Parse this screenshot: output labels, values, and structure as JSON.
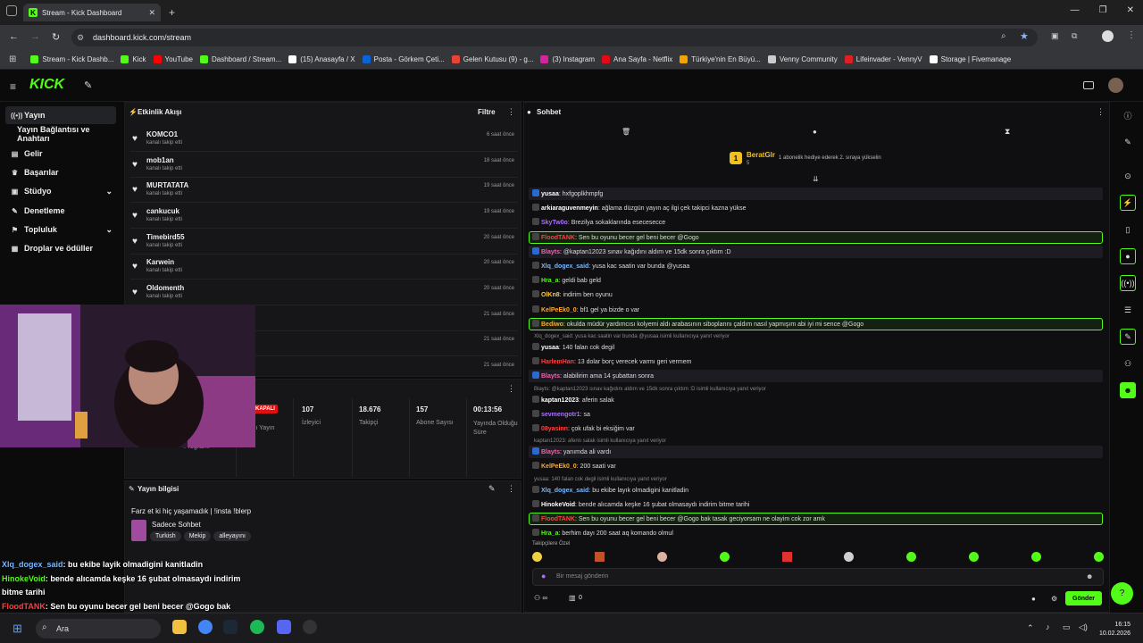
{
  "browser": {
    "tab_title": "Stream - Kick Dashboard",
    "url": "dashboard.kick.com/stream",
    "bookmarks": [
      {
        "label": "Stream - Kick Dashb...",
        "color": "#53fc18"
      },
      {
        "label": "Kick",
        "color": "#53fc18"
      },
      {
        "label": "YouTube",
        "color": "#ff0000"
      },
      {
        "label": "Dashboard / Stream...",
        "color": "#53fc18"
      },
      {
        "label": "(15) Anasayfa / X",
        "color": "#ffffff"
      },
      {
        "label": "Posta - Görkem Çeti...",
        "color": "#0a64d6"
      },
      {
        "label": "Gelen Kutusu (9) - g...",
        "color": "#ea4335"
      },
      {
        "label": "(3) Instagram",
        "color": "#d6249f"
      },
      {
        "label": "Ana Sayfa - Netflix",
        "color": "#e50914"
      },
      {
        "label": "Türkiye'nin En Büyü...",
        "color": "#f4a300"
      },
      {
        "label": "Venny Community",
        "color": "#cccccc"
      },
      {
        "label": "Lifeinvader - VennyV",
        "color": "#e02020"
      },
      {
        "label": "Storage | Fivemanage",
        "color": "#ffffff"
      }
    ]
  },
  "app": {
    "logo": "KICK"
  },
  "nav": {
    "items": [
      {
        "label": "Yayın",
        "icon": "broadcast-icon"
      },
      {
        "label": "Yayın Bağlantısı ve Anahtarı",
        "icon": ""
      },
      {
        "label": "Gelir",
        "icon": "wallet-icon"
      },
      {
        "label": "Başarılar",
        "icon": "trophy-icon"
      },
      {
        "label": "Stüdyo",
        "icon": "studio-icon"
      },
      {
        "label": "Denetleme",
        "icon": "wrench-icon"
      },
      {
        "label": "Topluluk",
        "icon": "community-icon"
      },
      {
        "label": "Droplar ve ödüller",
        "icon": "gift-icon"
      }
    ]
  },
  "activity": {
    "title": "Etkinlik Akışı",
    "filter": "Filtre",
    "items": [
      {
        "name": "KOMCO1",
        "sub": "kanalı takip etti",
        "time": "6 saat önce"
      },
      {
        "name": "mob1an",
        "sub": "kanalı takip etti",
        "time": "18 saat önce"
      },
      {
        "name": "MURTATATA",
        "sub": "kanalı takip etti",
        "time": "19 saat önce"
      },
      {
        "name": "cankucuk",
        "sub": "kanalı takip etti",
        "time": "19 saat önce"
      },
      {
        "name": "Timebird55",
        "sub": "kanalı takip etti",
        "time": "20 saat önce"
      },
      {
        "name": "Karwein",
        "sub": "kanalı takip etti",
        "time": "20 saat önce"
      },
      {
        "name": "Oldomenth",
        "sub": "kanalı takip etti",
        "time": "20 saat önce"
      },
      {
        "name": "",
        "sub": "",
        "time": "21 saat önce"
      },
      {
        "name": "",
        "sub": "",
        "time": "21 saat önce"
      },
      {
        "name": "",
        "sub": "",
        "time": "21 saat önce"
      }
    ]
  },
  "stats": {
    "live_label": "KAPALI",
    "live_sub": "Canlı Yayın",
    "program": "Programı",
    "viewers": "107",
    "viewers_label": "İzleyici",
    "followers": "18.676",
    "followers_label": "Takipçi",
    "subs": "157",
    "subs_label": "Abone Sayısı",
    "uptime": "00:13:56",
    "uptime_label": "Yayında Olduğu Süre"
  },
  "stream_info": {
    "title": "Yayın bilgisi",
    "stream_title": "Farz et ki hiç yaşamadık | !insta !blerp",
    "category": "Sadece Sohbet",
    "tags": [
      "Turkish",
      "Mekip",
      "alleyayını"
    ]
  },
  "chat": {
    "title": "Sohbet",
    "pinned_user": "BeratGlr",
    "pinned_count": "5",
    "pinned_msg": "1 abonelik hediye ederek 2. sıraya yükselin",
    "placeholder": "Bir mesaj gönderin",
    "send": "Gönder",
    "followers_only": "Takipçilere Özel",
    "bottom_count": "0",
    "messages": [
      {
        "user": "yusaa",
        "color": "#ffffff",
        "text": "hxfgoplkhmpfg",
        "style": "box"
      },
      {
        "user": "arkiaraguvenmeyin",
        "color": "#ffffff",
        "text": "ağlama düzgün yayın aç ilgi çek takipci kazna yükse",
        "style": ""
      },
      {
        "user": "SkyTw0o",
        "color": "#a970ff",
        "text": "Brezilya sokaklarında esecesecce",
        "style": ""
      },
      {
        "user": "FloodTANK",
        "color": "#ff4040",
        "text": "Sen bu oyunu becer gel beni becer @Gogo",
        "style": "hl"
      },
      {
        "user": "Blayts",
        "color": "#ff5db0",
        "text": "@kaptan12023 sınav kağıdını aldım ve 15dk sonra çıktım :D",
        "style": "box"
      },
      {
        "user": "Xlq_dogex_said",
        "color": "#7ab8ff",
        "text": "yusa kac saatin var bunda @yusaa",
        "style": ""
      },
      {
        "user": "Hra_a",
        "color": "#53fc18",
        "text": "geldi bab geld",
        "style": ""
      },
      {
        "user": "OlKn8",
        "color": "#ffcc33",
        "text": "indirim ben oyunu",
        "style": ""
      },
      {
        "user": "KelPeEk0_0",
        "color": "#ffaa33",
        "text": "bf1 gel ya bizde o var",
        "style": ""
      },
      {
        "user": "Bediwo",
        "color": "#ffaa33",
        "text": "okulda müdür yardımcısı kolyemi aldı arabasının siboplarını çaldım nasıl yapmışım abi iyi mi sence @Gogo",
        "style": "hl"
      },
      {
        "user": "yusaa",
        "color": "#ffffff",
        "text": "140 falan cok degil",
        "style": "",
        "reply": "Xlq_dogex_said: yusa kac saatin var bunda @yusaa isimli kullanıcıya yanıt veriyor"
      },
      {
        "user": "HarlemHan",
        "color": "#ff4040",
        "text": "13 dolar borç verecek varmı geri vermem",
        "style": ""
      },
      {
        "user": "Blayts",
        "color": "#ff5db0",
        "text": "alabilirim ama 14 şubattan sonra",
        "style": "box"
      },
      {
        "user": "kaptan12023",
        "color": "#ffffff",
        "text": "aferin salak",
        "style": "",
        "reply": "Blayts: @kaptan12023 sınav kağıdını aldım ve 15dk sonra çıktım :D isimli kullanıcıya yanıt veriyor"
      },
      {
        "user": "sevmengotr1",
        "color": "#a970ff",
        "text": "sa",
        "style": ""
      },
      {
        "user": "08yasinn",
        "color": "#ff4040",
        "text": "çok ufak bi eksiğim var",
        "style": ""
      },
      {
        "user": "Blayts",
        "color": "#ff5db0",
        "text": "yanımda ali vardı",
        "style": "box",
        "reply": "kaptan12023: aferin salak isimli kullanıcıya yanıt veriyor"
      },
      {
        "user": "KelPeEk0_0",
        "color": "#ffaa33",
        "text": "200 saati var",
        "style": ""
      },
      {
        "user": "Xlq_dogex_said",
        "color": "#7ab8ff",
        "text": "bu ekibe layık olmadigini kanitladin",
        "style": "",
        "reply": "yusaa: 140 falan cok degil isimli kullanıcıya yanıt veriyor"
      },
      {
        "user": "HinokeVoid",
        "color": "#ffffff",
        "text": "bende alıcamda keşke 16 şubat olmasaydı indirim bitme tarihi",
        "style": ""
      },
      {
        "user": "FloodTANK",
        "color": "#ff4040",
        "text": "Sen bu oyunu becer gel beni becer @Gogo bak tasak geciyorsam ne olayim cok zor amk",
        "style": "hl"
      },
      {
        "user": "Hra_a",
        "color": "#53fc18",
        "text": "berhim dayı 200 saat aq komando olmul",
        "style": ""
      }
    ]
  },
  "overlay": {
    "lines": [
      {
        "user": "Xlq_dogex_said",
        "color": "#7ab8ff",
        "text": ": bu ekibe layik olmadigini kanitladin"
      },
      {
        "user": "HinokeVoid",
        "color": "#53fc18",
        "text": ": bende alıcamda keşke 16 şubat olmasaydı indirim"
      },
      {
        "user": "",
        "color": "#fff",
        "text": "bitme tarihi"
      },
      {
        "user": "FloodTANK",
        "color": "#ff4040",
        "text": ": Sen bu oyunu becer gel beni becer @Gogo bak"
      },
      {
        "user": "",
        "color": "#fff",
        "text": "tasak geciyorsam ne olayim cok zor amk"
      }
    ]
  },
  "taskbar": {
    "search": "Ara",
    "time": "16:15",
    "date": "10.02.2026"
  }
}
